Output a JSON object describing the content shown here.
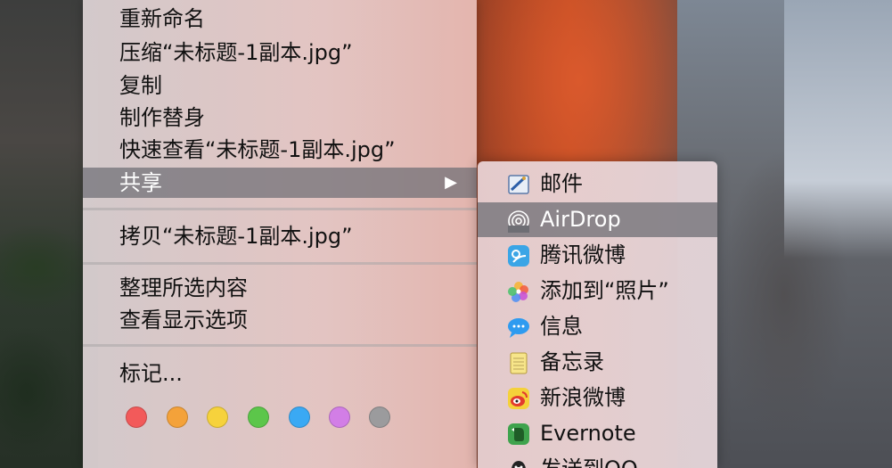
{
  "context_menu": {
    "items_top": [
      "重新命名",
      "压缩“未标题-1副本.jpg”",
      "复制",
      "制作替身",
      "快速查看“未标题-1副本.jpg”"
    ],
    "share_label": "共享",
    "share_arrow": "▶",
    "copy_item": "拷贝“未标题-1副本.jpg”",
    "arrange_items": [
      "整理所选内容",
      "查看显示选项"
    ],
    "tags_label": "标记...",
    "tag_colors": [
      "#f25a5a",
      "#f4a23a",
      "#f6d23c",
      "#5cc64a",
      "#3aa9f4",
      "#d27ee6",
      "#9b9b9d"
    ]
  },
  "share_submenu": {
    "items": [
      {
        "label": "邮件",
        "icon": "mail-icon"
      },
      {
        "label": "AirDrop",
        "icon": "airdrop-icon"
      },
      {
        "label": "腾讯微博",
        "icon": "tencent-weibo-icon"
      },
      {
        "label": "添加到“照片”",
        "icon": "photos-icon"
      },
      {
        "label": "信息",
        "icon": "messages-icon"
      },
      {
        "label": "备忘录",
        "icon": "notes-icon"
      },
      {
        "label": "新浪微博",
        "icon": "sina-weibo-icon"
      },
      {
        "label": "Evernote",
        "icon": "evernote-icon"
      },
      {
        "label": "发送到QQ",
        "icon": "qq-icon"
      }
    ]
  }
}
